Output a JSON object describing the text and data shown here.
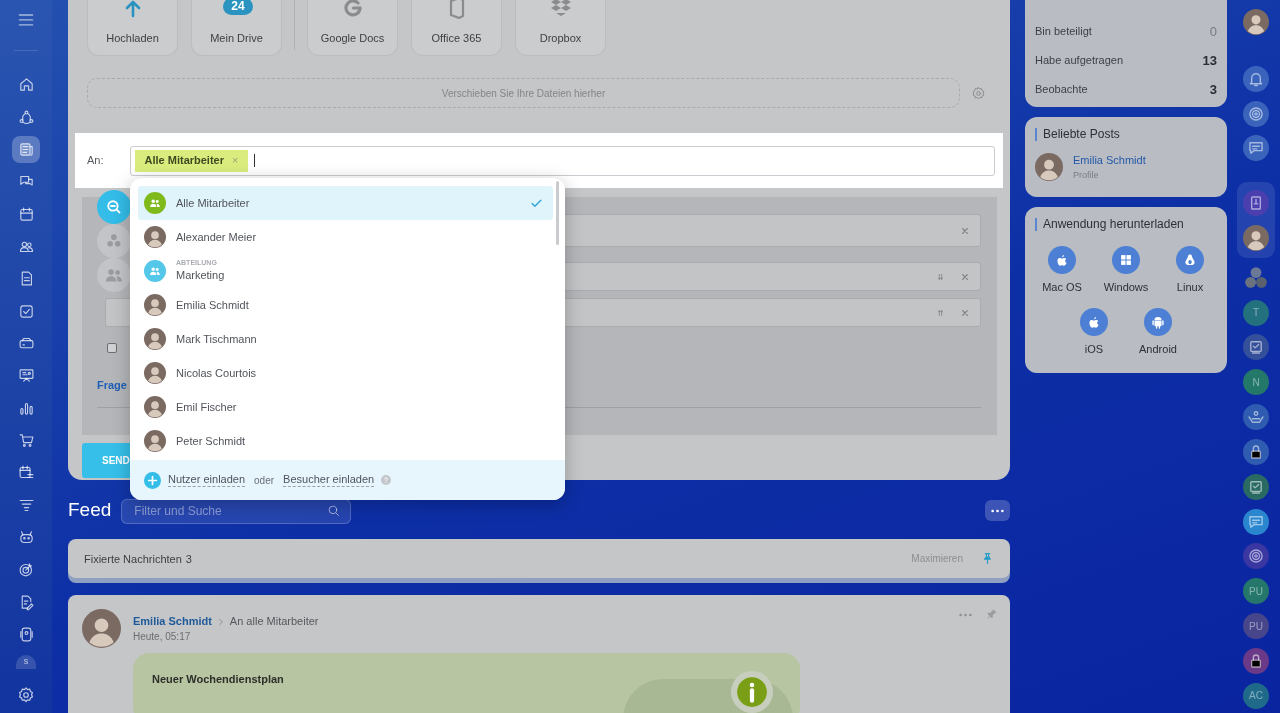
{
  "sidebar": {
    "items": [
      {
        "selected": false
      },
      {
        "selected": false
      },
      {
        "selected": true
      },
      {
        "selected": false
      },
      {
        "selected": false
      },
      {
        "selected": false
      },
      {
        "selected": false
      },
      {
        "selected": false
      },
      {
        "selected": false
      },
      {
        "selected": false
      },
      {
        "selected": false
      },
      {
        "selected": false
      },
      {
        "selected": false
      },
      {
        "selected": false
      },
      {
        "selected": false
      },
      {
        "selected": false
      },
      {
        "selected": false
      },
      {
        "selected": false
      },
      {
        "selected": false,
        "label": "s"
      },
      {
        "selected": false
      }
    ]
  },
  "file_sources": [
    {
      "kind": "upload",
      "label": "Hochladen"
    },
    {
      "kind": "drive",
      "label": "Mein Drive",
      "badge": "24"
    },
    {
      "kind": "google",
      "label": "Google Docs"
    },
    {
      "kind": "office",
      "label": "Office 365"
    },
    {
      "kind": "dropbox",
      "label": "Dropbox"
    }
  ],
  "dropzone": {
    "text": "Verschieben Sie Ihre Dateien hierher"
  },
  "recipients": {
    "label": "An:",
    "tags": [
      {
        "label": "Alle Mitarbeiter",
        "remove": "×"
      }
    ]
  },
  "form": {
    "link": "Frage",
    "send_button": "SEND",
    "checkbox": {
      "checked": false
    }
  },
  "recipient_dropdown": {
    "items": [
      {
        "kind": "group",
        "name": "Alle Mitarbeiter",
        "selected": true
      },
      {
        "kind": "person",
        "name": "Alexander Meier",
        "selected": false
      },
      {
        "kind": "department",
        "caption": "ABTEILUNG",
        "name": "Marketing",
        "selected": false
      },
      {
        "kind": "person",
        "name": "Emilia Schmidt",
        "selected": false
      },
      {
        "kind": "person",
        "name": "Mark Tischmann",
        "selected": false
      },
      {
        "kind": "person",
        "name": "Nicolas Courtois",
        "selected": false
      },
      {
        "kind": "person",
        "name": "Emil Fischer",
        "selected": false
      },
      {
        "kind": "person",
        "name": "Peter Schmidt",
        "selected": false
      }
    ],
    "footer": {
      "invite_users": "Nutzer einladen",
      "or": "oder",
      "invite_guests": "Besucher einladen"
    }
  },
  "feed": {
    "title": "Feed",
    "search_placeholder": "Filter und Suche",
    "pinned": {
      "label": "Fixierte Nachrichten",
      "count": "3",
      "action": "Maximieren"
    },
    "posts": [
      {
        "author": "Emilia Schmidt",
        "audience": "An alle Mitarbeiter",
        "time": "Heute, 05:17",
        "card_title": "Neuer Wochendienstplan"
      }
    ]
  },
  "task_counters": [
    {
      "label": "Bin beteiligt",
      "value": "0",
      "zero": true
    },
    {
      "label": "Habe aufgetragen",
      "value": "13",
      "zero": false
    },
    {
      "label": "Beobachte",
      "value": "3",
      "zero": false
    }
  ],
  "popular_posts": {
    "title": "Beliebte Posts",
    "items": [
      {
        "name": "Emilia Schmidt",
        "subtitle": "Profile"
      }
    ]
  },
  "download_app": {
    "title": "Anwendung herunterladen",
    "apps": [
      {
        "kind": "apple",
        "label": "Mac OS"
      },
      {
        "kind": "windows",
        "label": "Windows"
      },
      {
        "kind": "linux",
        "label": "Linux"
      },
      {
        "kind": "apple",
        "label": "iOS"
      },
      {
        "kind": "android",
        "label": "Android"
      }
    ]
  },
  "right_bar": {
    "items": [
      {
        "kind": "avatar"
      },
      {
        "kind": "bell"
      },
      {
        "kind": "swirl"
      },
      {
        "kind": "chat"
      },
      {
        "kind": "book",
        "color": "#4b3fb0",
        "selected": true
      },
      {
        "kind": "avatar",
        "selected": true
      },
      {
        "kind": "group"
      },
      {
        "kind": "letter",
        "label": "T",
        "color": "#23707e"
      },
      {
        "kind": "task",
        "color": "#35509a"
      },
      {
        "kind": "letter",
        "label": "N",
        "color": "#23786a"
      },
      {
        "kind": "hands",
        "color": "#2f5cb0"
      },
      {
        "kind": "lock",
        "color": "#2f5cb0"
      },
      {
        "kind": "task",
        "color": "#2a6a62"
      },
      {
        "kind": "chat",
        "color": "#2a86cf"
      },
      {
        "kind": "swirl",
        "color": "#3a36a2"
      },
      {
        "kind": "letter",
        "label": "PU",
        "color": "#24776a"
      },
      {
        "kind": "letter",
        "label": "PU",
        "color": "#48468a"
      },
      {
        "kind": "lock",
        "color": "#6a3a88"
      },
      {
        "kind": "letter",
        "label": "AC",
        "color": "#1f6a88"
      }
    ]
  }
}
